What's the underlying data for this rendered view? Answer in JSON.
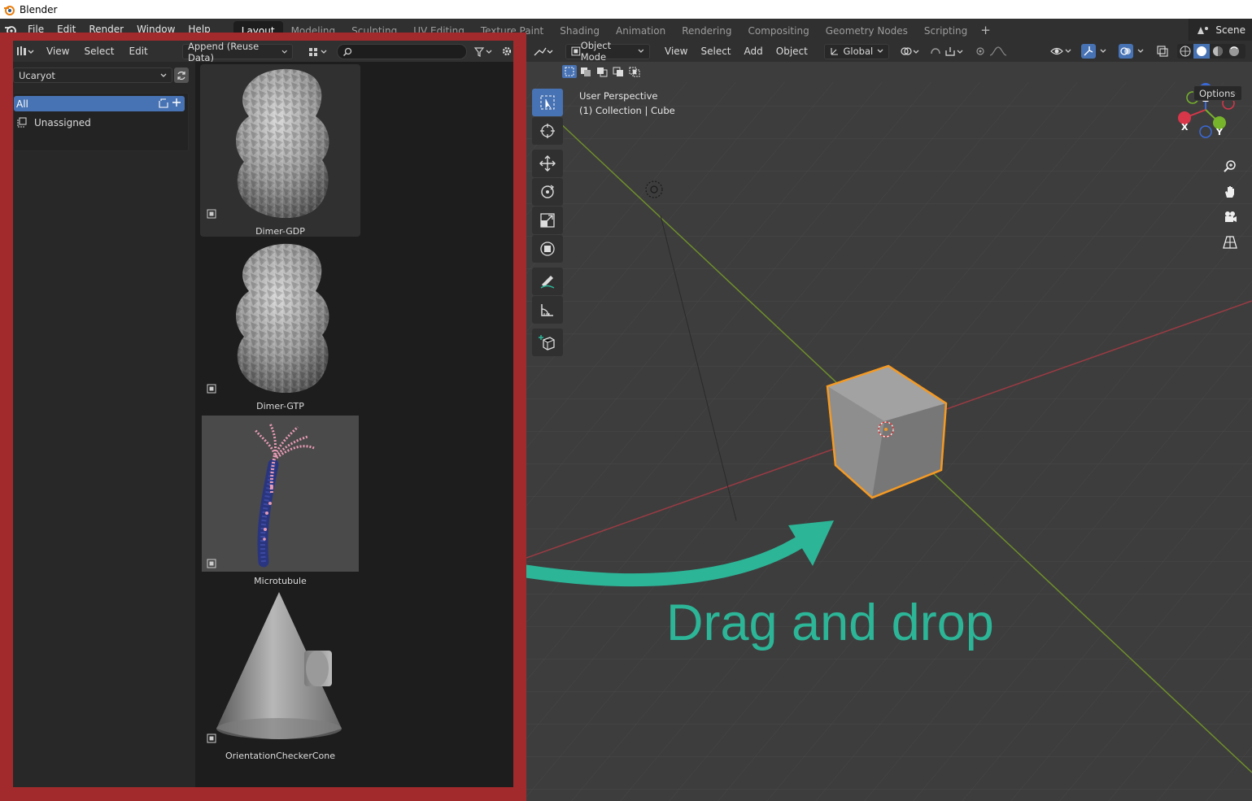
{
  "window": {
    "title": "Blender"
  },
  "menubar": {
    "items": [
      "File",
      "Edit",
      "Render",
      "Window",
      "Help"
    ]
  },
  "workspaces": {
    "tabs": [
      "Layout",
      "Modeling",
      "Sculpting",
      "UV Editing",
      "Texture Paint",
      "Shading",
      "Animation",
      "Rendering",
      "Compositing",
      "Geometry Nodes",
      "Scripting"
    ],
    "active": "Layout",
    "scene": "Scene"
  },
  "asset_browser": {
    "header": {
      "view": "View",
      "select": "Select",
      "edit": "Edit",
      "import_method": "Append (Reuse Data)",
      "search_placeholder": ""
    },
    "library": "Ucaryot",
    "catalogs": {
      "all": "All",
      "unassigned": "Unassigned"
    },
    "assets": [
      {
        "name": "Dimer-GDP"
      },
      {
        "name": "Dimer-GTP"
      },
      {
        "name": "Microtubule"
      },
      {
        "name": "OrientationCheckerCone"
      }
    ]
  },
  "viewport": {
    "header": {
      "mode": "Object Mode",
      "view": "View",
      "select": "Select",
      "add": "Add",
      "object": "Object",
      "orientation": "Global"
    },
    "options": "Options",
    "info_line1": "User Perspective",
    "info_line2": "(1) Collection | Cube",
    "gizmo": {
      "x": "X",
      "y": "Y",
      "z": "Z"
    }
  },
  "annotation": {
    "text": "Drag and drop",
    "color": "#2cb597"
  },
  "colors": {
    "accent_blue": "#4772b3",
    "highlight_red": "#a32a2c",
    "selection_orange": "#f59a23",
    "x_axis": "#bf3a45",
    "y_axis": "#75a02a"
  }
}
